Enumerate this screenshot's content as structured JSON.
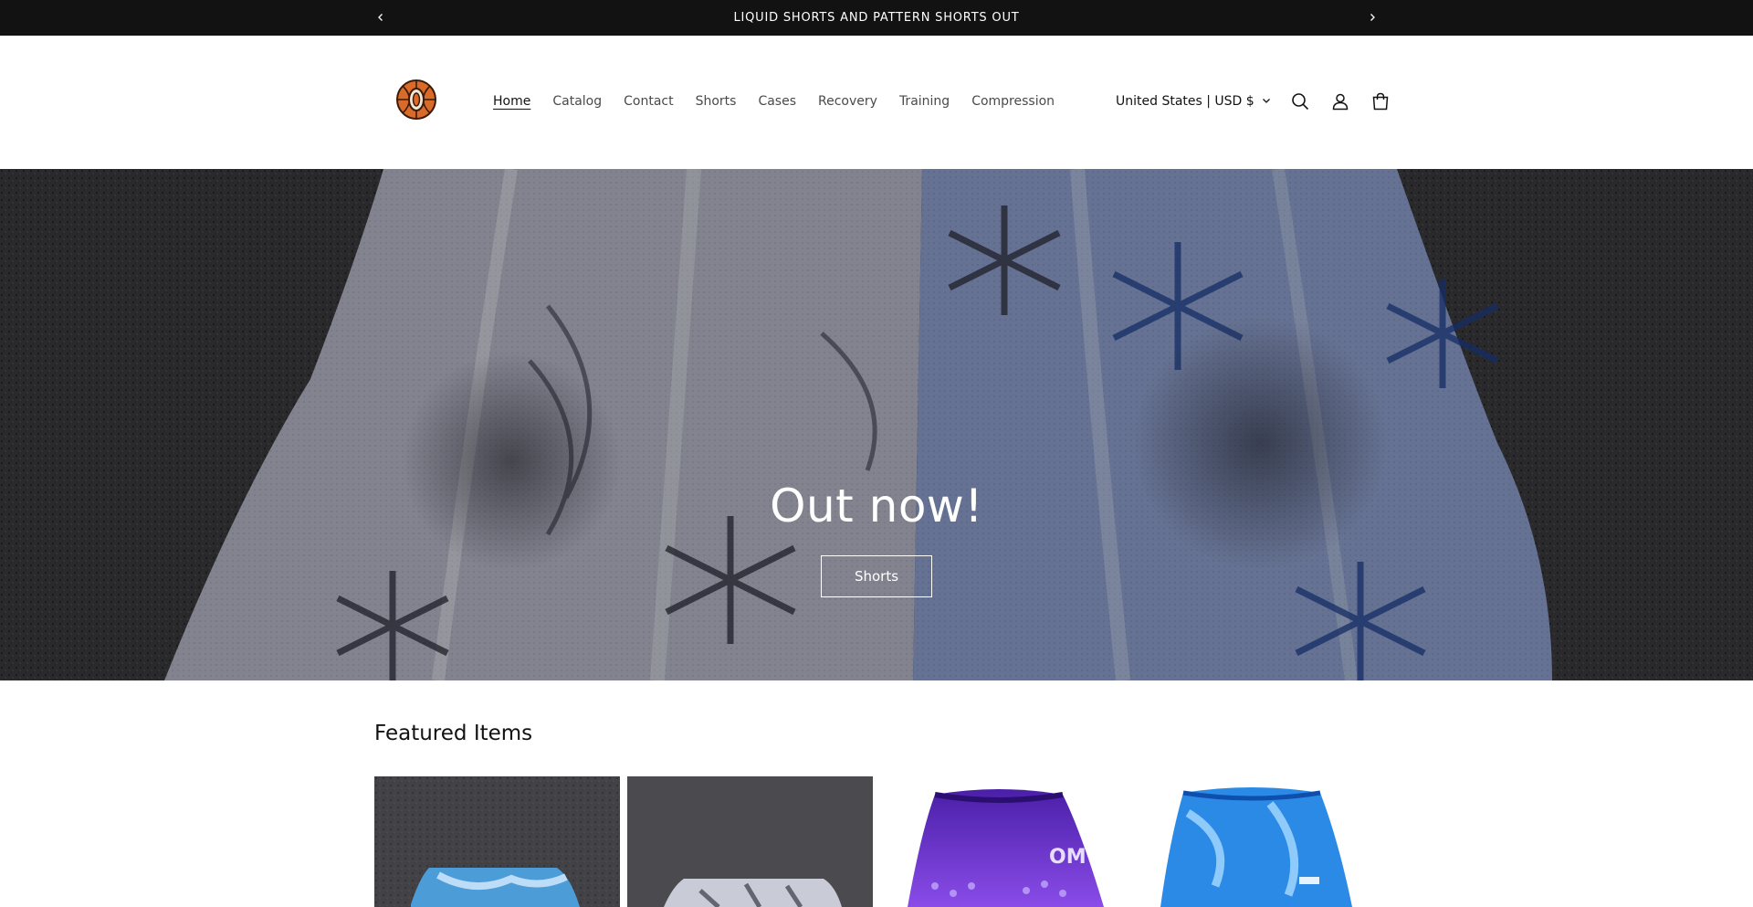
{
  "announcement": {
    "text": "LIQUID SHORTS AND PATTERN SHORTS OUT",
    "prev_icon": "chevron-left-icon",
    "next_icon": "chevron-right-icon"
  },
  "header": {
    "logo_icon": "basketball-logo-icon",
    "nav": [
      {
        "label": "Home",
        "active": true
      },
      {
        "label": "Catalog",
        "active": false
      },
      {
        "label": "Contact",
        "active": false
      },
      {
        "label": "Shorts",
        "active": false
      },
      {
        "label": "Cases",
        "active": false
      },
      {
        "label": "Recovery",
        "active": false
      },
      {
        "label": "Training",
        "active": false
      },
      {
        "label": "Compression",
        "active": false
      }
    ],
    "country_selector": "United States | USD $",
    "icons": [
      "search-icon",
      "account-icon",
      "cart-icon"
    ]
  },
  "hero": {
    "title": "Out now!",
    "button_label": "Shorts"
  },
  "featured": {
    "title": "Featured Items",
    "products": [
      {
        "image": "blue-tie-dye-shorts-on-asphalt"
      },
      {
        "image": "white-pattern-shorts-on-asphalt"
      },
      {
        "image": "purple-pattern-shorts"
      },
      {
        "image": "blue-liquid-shorts"
      }
    ]
  },
  "colors": {
    "announcement_bg": "#121212",
    "text": "#121212",
    "nav_text": "#4a4a4a",
    "background": "#ffffff"
  }
}
